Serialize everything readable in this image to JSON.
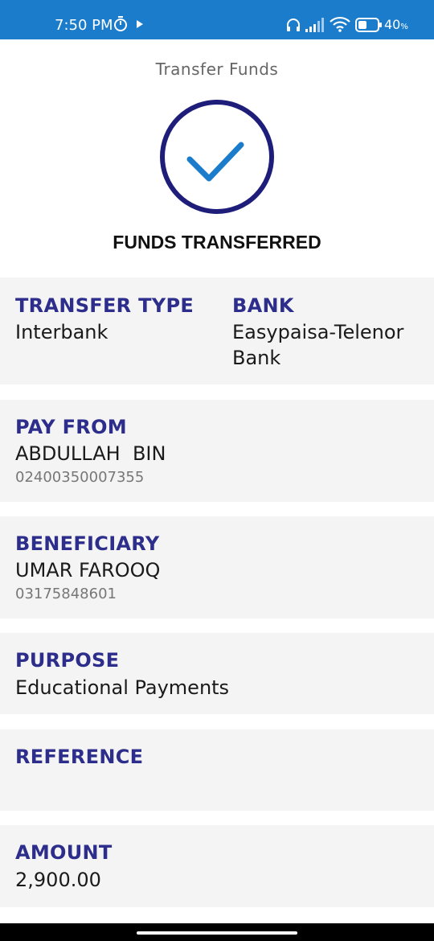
{
  "status_bar": {
    "time": "7:50 PM",
    "battery_percent": "40",
    "battery_unit": "%",
    "icons": [
      "timer-icon",
      "play-icon",
      "headphones-icon",
      "signal-icon",
      "wifi-icon",
      "battery-icon"
    ]
  },
  "header": {
    "title": "Transfer Funds"
  },
  "result": {
    "heading": "FUNDS TRANSFERRED",
    "icon": "check-circle-icon"
  },
  "details": {
    "transfer_type": {
      "label": "TRANSFER TYPE",
      "value": "Interbank"
    },
    "bank": {
      "label": "BANK",
      "value_line1": "Easypaisa-Telenor",
      "value_line2": "Bank"
    },
    "pay_from": {
      "label": "PAY FROM",
      "name": "ABDULLAH  BIN",
      "account": "02400350007355"
    },
    "beneficiary": {
      "label": "BENEFICIARY",
      "name": "UMAR FAROOQ",
      "account": "03175848601"
    },
    "purpose": {
      "label": "PURPOSE",
      "value": "Educational Payments"
    },
    "reference": {
      "label": "REFERENCE",
      "value": ""
    },
    "amount": {
      "label": "AMOUNT",
      "value": "2,900.00"
    }
  },
  "colors": {
    "status_bar": "#1a7ccb",
    "label": "#2d2d8c",
    "card_bg": "#f4f4f4",
    "check_ring": "#1e1e7a",
    "check_mark": "#1a7ccb"
  }
}
